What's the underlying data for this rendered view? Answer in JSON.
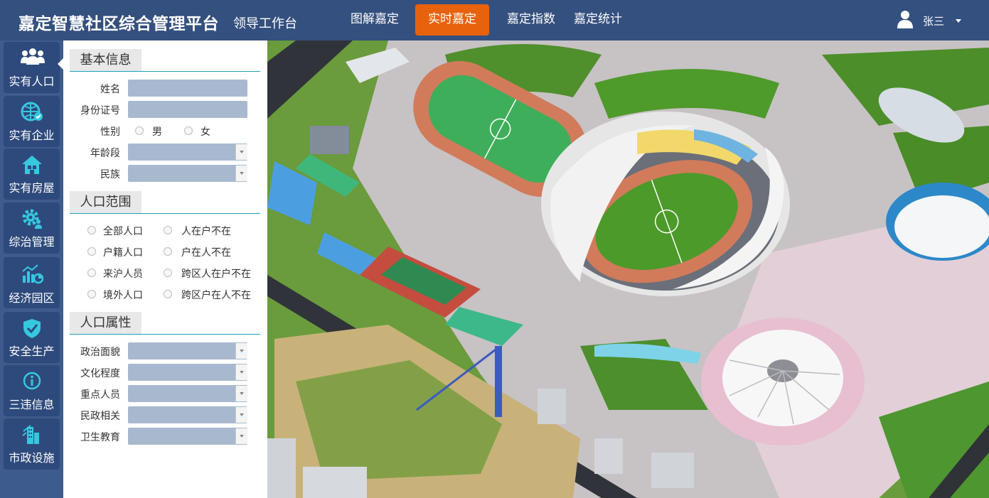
{
  "header": {
    "brand_title": "嘉定智慧社区综合管理平台",
    "brand_subtitle": "领导工作台",
    "nav": [
      {
        "label": "图解嘉定",
        "active": false
      },
      {
        "label": "实时嘉定",
        "active": true
      },
      {
        "label": "嘉定指数",
        "active": false
      },
      {
        "label": "嘉定统计",
        "active": false
      }
    ],
    "user_name": "张三",
    "accent_color": "#e8620d"
  },
  "sidebar": {
    "items": [
      {
        "label": "实有人口",
        "icon": "people-icon",
        "active": true
      },
      {
        "label": "实有企业",
        "icon": "globe-enterprise-icon"
      },
      {
        "label": "实有房屋",
        "icon": "house-icon"
      },
      {
        "label": "综治管理",
        "icon": "gear-person-icon"
      },
      {
        "label": "经济园区",
        "icon": "chart-icon"
      },
      {
        "label": "安全生产",
        "icon": "shield-icon"
      },
      {
        "label": "三违信息",
        "icon": "info-icon"
      },
      {
        "label": "市政设施",
        "icon": "building-icon"
      }
    ]
  },
  "panel": {
    "basic_info": {
      "title": "基本信息",
      "name_label": "姓名",
      "name_value": "",
      "id_label": "身份证号",
      "id_value": "",
      "gender_label": "性别",
      "gender_options": [
        "男",
        "女"
      ],
      "age_label": "年龄段",
      "age_value": "",
      "ethnicity_label": "民族",
      "ethnicity_value": ""
    },
    "population_scope": {
      "title": "人口范围",
      "options": [
        "全部人口",
        "人在户不在",
        "户籍人口",
        "户在人不在",
        "来沪人员",
        "跨区人在户不在",
        "境外人口",
        "跨区户在人不在"
      ]
    },
    "population_attr": {
      "title": "人口属性",
      "fields": [
        {
          "label": "政治面貌",
          "value": ""
        },
        {
          "label": "文化程度",
          "value": ""
        },
        {
          "label": "重点人员",
          "value": ""
        },
        {
          "label": "民政相关",
          "value": ""
        },
        {
          "label": "卫生教育",
          "value": ""
        }
      ]
    }
  }
}
